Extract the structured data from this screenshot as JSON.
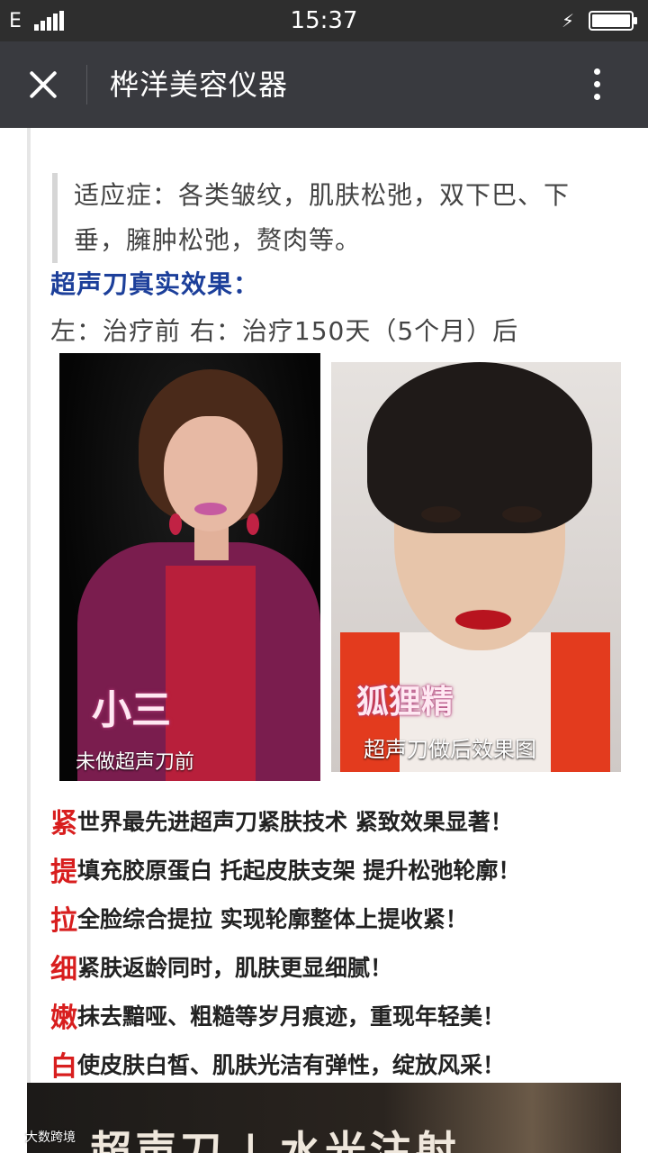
{
  "status_bar": {
    "network": "E",
    "time": "15:37",
    "usb_icon": "usb-debug-icon",
    "battery_level": 0.95
  },
  "title_bar": {
    "title": "桦洋美容仪器",
    "close_icon": "close-icon",
    "more_icon": "more-vertical-icon"
  },
  "article": {
    "indications": [
      "适应症：各类皱纹，肌肤松弛，双下巴、下",
      "垂，臃肿松弛，赘肉等。"
    ],
    "effect_title": "超声刀真实效果：",
    "compare_note": "左：治疗前  右：治疗150天（5个月）后",
    "photos": {
      "before": {
        "label_big": "小三",
        "label_small": "未做超声刀前"
      },
      "after": {
        "label_big": "狐狸精",
        "label_small": "超声刀做后效果图"
      }
    },
    "benefits": [
      {
        "key": "紧",
        "text": "世界最先进超声刀紧肤技术 紧致效果显著！"
      },
      {
        "key": "提",
        "text": "填充胶原蛋白 托起皮肤支架 提升松弛轮廓！"
      },
      {
        "key": "拉",
        "text": "全脸综合提拉 实现轮廓整体上提收紧！"
      },
      {
        "key": "细",
        "text": "紧肤返龄同时，肌肤更显细腻！"
      },
      {
        "key": "嫩",
        "text": "抹去黯哑、粗糙等岁月痕迹，重现年轻美！"
      },
      {
        "key": "白",
        "text": "使皮肤白皙、肌肤光洁有弹性，绽放风采！"
      }
    ],
    "banner_text": "超声刀 | 水光注射",
    "watermark": "大数跨境"
  }
}
